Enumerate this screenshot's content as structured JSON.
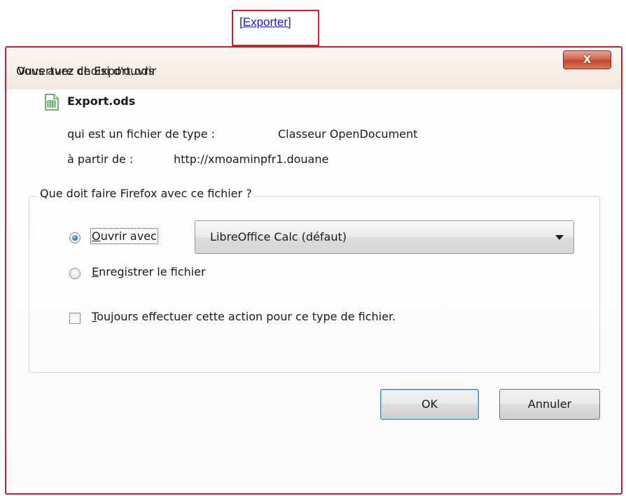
{
  "link": {
    "text": "Exporter",
    "open_bracket": "[",
    "close_bracket": "]"
  },
  "dialog": {
    "title": "Ouverture de Export.ods",
    "close_label": "X",
    "intro": "Vous avez choisi d'ouvrir",
    "file": {
      "icon": "spreadsheet-file-icon",
      "name": "Export.ods",
      "type_label": "qui est un fichier de type :",
      "type_value": "Classeur OpenDocument",
      "from_label": "à partir de :",
      "from_value": "http://xmoaminpfr1.douane"
    },
    "group": {
      "legend": "Que doit faire Firefox avec ce fichier ?",
      "open_with": {
        "label_u": "O",
        "label_rest": "uvrir avec",
        "checked": true
      },
      "app_select": {
        "value": "LibreOffice Calc (défaut)"
      },
      "save": {
        "label_u": "E",
        "label_rest": "nregistrer le fichier",
        "checked": false
      },
      "always": {
        "label_u": "T",
        "label_rest": "oujours effectuer cette action pour ce type de fichier.",
        "checked": false
      }
    },
    "buttons": {
      "ok": "OK",
      "cancel": "Annuler"
    }
  },
  "colors": {
    "highlight_border": "#c8262c",
    "link": "#1a1acc",
    "close_button": "#c24630"
  }
}
